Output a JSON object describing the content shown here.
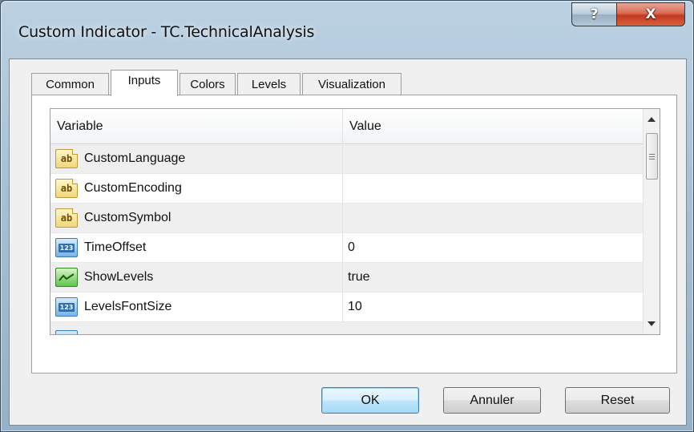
{
  "window": {
    "title": "Custom Indicator - TC.TechnicalAnalysis",
    "help_glyph": "?",
    "close_glyph": "X"
  },
  "tabs": [
    {
      "label": "Common"
    },
    {
      "label": "Inputs",
      "active": true
    },
    {
      "label": "Colors"
    },
    {
      "label": "Levels"
    },
    {
      "label": "Visualization"
    }
  ],
  "list": {
    "columns": {
      "variable": "Variable",
      "value": "Value"
    },
    "rows": [
      {
        "icon": "ab-string-icon",
        "name": "CustomLanguage",
        "value": ""
      },
      {
        "icon": "ab-string-icon",
        "name": "CustomEncoding",
        "value": ""
      },
      {
        "icon": "ab-string-icon",
        "name": "CustomSymbol",
        "value": ""
      },
      {
        "icon": "integer-123-icon",
        "name": "TimeOffset",
        "value": "0"
      },
      {
        "icon": "boolean-chart-icon",
        "name": "ShowLevels",
        "value": "true"
      },
      {
        "icon": "integer-123-icon",
        "name": "LevelsFontSize",
        "value": "10"
      }
    ]
  },
  "buttons": {
    "ok": "OK",
    "cancel": "Annuler",
    "reset": "Reset"
  },
  "colors": {
    "default_button_border": "#3c7fb1",
    "close_button": "#c23a1f",
    "row_alt": "#efefef"
  }
}
